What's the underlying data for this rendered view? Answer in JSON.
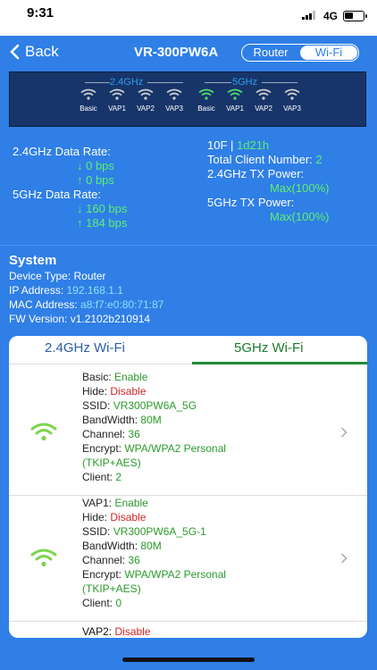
{
  "status": {
    "time": "9:31",
    "network": "4G"
  },
  "nav": {
    "back_label": "Back",
    "title": "VR-300PW6A",
    "seg_router": "Router",
    "seg_wifi": "Wi-Fi"
  },
  "panel": {
    "band_24": "2.4GHz",
    "band_5": "5GHz",
    "ports": [
      {
        "label": "Basic",
        "color": "#d0d0d0"
      },
      {
        "label": "VAP1",
        "color": "#d0d0d0"
      },
      {
        "label": "VAP2",
        "color": "#d0d0d0"
      },
      {
        "label": "VAP3",
        "color": "#d0d0d0"
      },
      {
        "label": "Basic",
        "color": "#4ee06a"
      },
      {
        "label": "VAP1",
        "color": "#4ee06a"
      },
      {
        "label": "VAP2",
        "color": "#d0d0d0"
      },
      {
        "label": "VAP3",
        "color": "#d0d0d0"
      }
    ]
  },
  "rates": {
    "r24_label": "2.4GHz Data Rate:",
    "r24_down": "↓ 0 bps",
    "r24_up": "↑ 0 bps",
    "r5_label": "5GHz Data Rate:",
    "r5_down": "↓ 160 bps",
    "r5_up": "↑ 184 bps"
  },
  "stats": {
    "floor": "10F | ",
    "uptime": "1d21h",
    "clients_label": "Total Client Number: ",
    "clients": "2",
    "tx24_label": "2.4GHz TX Power:",
    "tx24": "Max(100%)",
    "tx5_label": "5GHz TX Power:",
    "tx5": "Max(100%)"
  },
  "system": {
    "title": "System",
    "device_label": "Device Type: ",
    "device": "Router",
    "ip_label": "IP Address: ",
    "ip": "192.168.1.1",
    "mac_label": "MAC Address: ",
    "mac": "a8:f7:e0:80:71:87",
    "fw_label": "FW Version: ",
    "fw": "v1.2102b210914"
  },
  "tabs": {
    "t24": "2.4GHz Wi-Fi",
    "t5": "5GHz Wi-Fi"
  },
  "entries": [
    {
      "name_label": "Basic:",
      "name_state": "Enable",
      "hide_label": "Hide:",
      "hide_state": "Disable",
      "ssid_label": "SSID:",
      "ssid": "VR300PW6A_5G",
      "bw_label": "BandWidth:",
      "bw": "80M",
      "ch_label": "Channel:",
      "ch": "36",
      "enc_label": "Encrypt:",
      "enc": "WPA/WPA2 Personal",
      "enc2": "(TKIP+AES)",
      "cl_label": "Client:",
      "cl": "2"
    },
    {
      "name_label": "VAP1:",
      "name_state": "Enable",
      "hide_label": "Hide:",
      "hide_state": "Disable",
      "ssid_label": "SSID:",
      "ssid": "VR300PW6A_5G-1",
      "bw_label": "BandWidth:",
      "bw": "80M",
      "ch_label": "Channel:",
      "ch": "36",
      "enc_label": "Encrypt:",
      "enc": "WPA/WPA2 Personal",
      "enc2": "(TKIP+AES)",
      "cl_label": "Client:",
      "cl": "0"
    }
  ],
  "vap2": {
    "label": "VAP2:",
    "state": "Disable"
  },
  "colors": {
    "accent": "#2f7fe6",
    "enable": "#2a9a2a",
    "disable": "#d02424",
    "panel": "#18356a"
  }
}
